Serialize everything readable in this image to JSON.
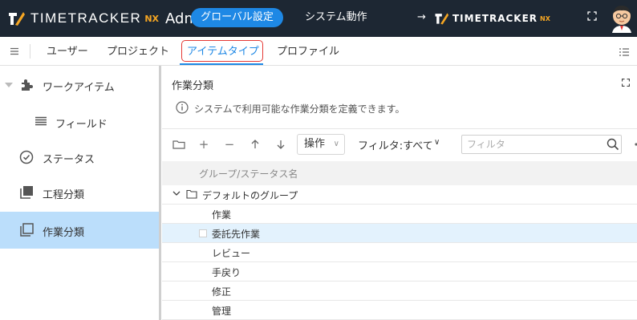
{
  "header": {
    "brand_name": "TIMETRACKER",
    "brand_nx": "NX",
    "brand_admin": "Admin",
    "nav_global": "グローバル設定",
    "nav_system": "システム動作",
    "nav_arrow": "→",
    "brand2_name": "TIMETRACKER",
    "brand2_nx": "NX"
  },
  "tabs": {
    "users": "ユーザー",
    "projects": "プロジェクト",
    "itemtype": "アイテムタイプ",
    "profile": "プロファイル"
  },
  "sidebar": {
    "items": [
      {
        "label": "ワークアイテム",
        "icon": "puzzle-icon"
      },
      {
        "label": "フィールド",
        "icon": "list-icon"
      },
      {
        "label": "ステータス",
        "icon": "check-circle-icon"
      },
      {
        "label": "工程分類",
        "icon": "stack-icon"
      },
      {
        "label": "作業分類",
        "icon": "copy-icon"
      }
    ],
    "selected_index": 4
  },
  "panel": {
    "title": "作業分類",
    "info": "システムで利用可能な作業分類を定義できます。"
  },
  "toolbar": {
    "op_label": "操作",
    "filter_label": "フィルタ:すべて",
    "filter_placeholder": "フィルタ"
  },
  "table": {
    "header": "グループ/ステータス名",
    "group": "デフォルトのグループ",
    "rows": [
      "作業",
      "委託先作業",
      "レビュー",
      "手戻り",
      "修正",
      "管理"
    ],
    "selected_row": 1
  },
  "colors": {
    "topbar_bg": "#1d2733",
    "accent": "#1e88e5",
    "brand_nx": "#f5a623",
    "sidebar_selected": "#bbdefb",
    "row_selected": "#e3f2fd",
    "tab_highlight_border": "#e53935"
  }
}
